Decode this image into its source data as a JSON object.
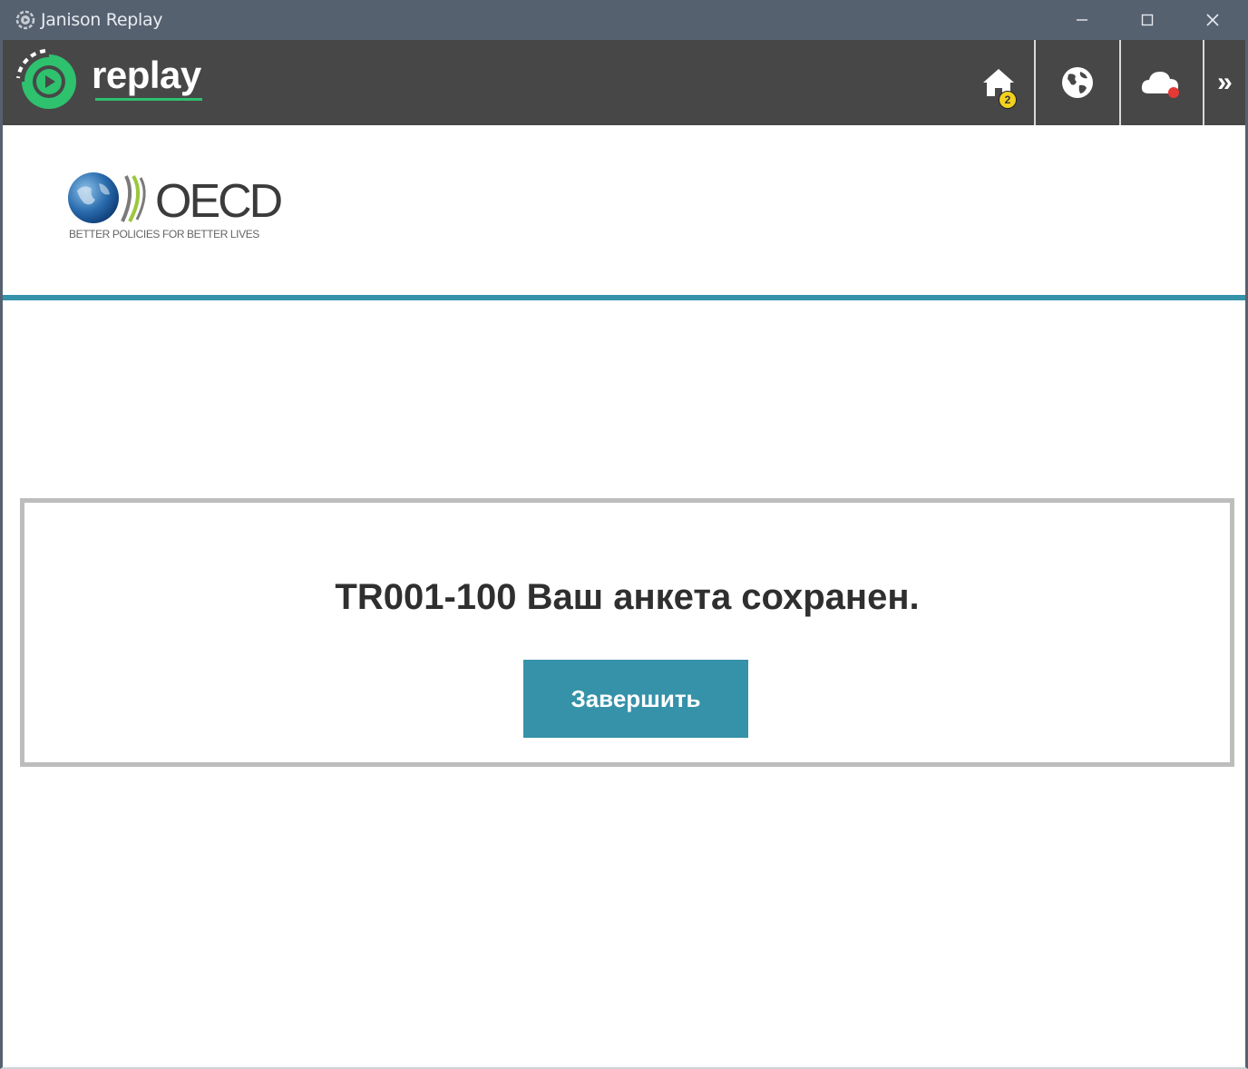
{
  "window": {
    "title": "Janison Replay",
    "controls": {
      "minimize": "–",
      "maximize": "☐",
      "close": "✕"
    }
  },
  "toolbar": {
    "brand": "replay",
    "home_badge": "2",
    "expand_label": "»",
    "icons": [
      "home-icon",
      "globe-icon",
      "cloud-icon",
      "double-chevron-right-icon"
    ],
    "colors": {
      "background": "#474747",
      "brand_green": "#2ec16e",
      "notification_red": "#e53935",
      "badge_yellow": "#f2d01f"
    }
  },
  "header": {
    "logo_text": "OECD",
    "logo_tagline": "BETTER POLICIES FOR BETTER LIVES",
    "accent_color": "#3592a9"
  },
  "main": {
    "message": "TR001-100 Ваш анкета сохранен.",
    "finish_button": "Завершить"
  }
}
